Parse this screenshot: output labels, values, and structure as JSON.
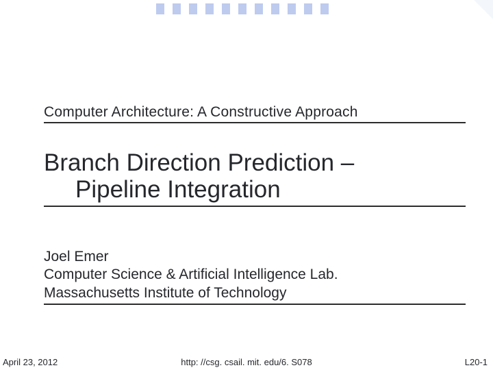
{
  "slide": {
    "course_line": "Computer Architecture: A Constructive Approach",
    "title_line1": "Branch Direction Prediction –",
    "title_line2": "Pipeline Integration",
    "author_name": "Joel Emer",
    "author_affiliation1": "Computer Science & Artificial Intelligence Lab.",
    "author_affiliation2": "Massachusetts Institute of Technology"
  },
  "footer": {
    "date": "April 23, 2012",
    "url": "http: //csg. csail. mit. edu/6. S078",
    "page": "L20-1"
  },
  "decor": {
    "tick_count": 11
  }
}
